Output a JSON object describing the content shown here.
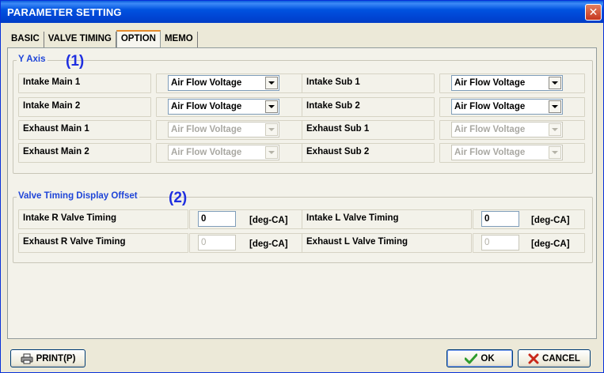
{
  "window": {
    "title": "PARAMETER SETTING",
    "close_glyph": "✕"
  },
  "tabs": [
    {
      "label": "BASIC",
      "active": false
    },
    {
      "label": "VALVE TIMING",
      "active": false
    },
    {
      "label": "OPTION",
      "active": true
    },
    {
      "label": "MEMO",
      "active": false
    }
  ],
  "y_axis": {
    "legend": "Y Axis",
    "marker": "(1)",
    "rows": [
      {
        "label": "Intake Main 1",
        "value": "Air Flow Voltage",
        "enabled": true
      },
      {
        "label": "Intake Main 2",
        "value": "Air Flow Voltage",
        "enabled": true
      },
      {
        "label": "Exhaust Main 1",
        "value": "Air Flow Voltage",
        "enabled": false
      },
      {
        "label": "Exhaust Main 2",
        "value": "Air Flow Voltage",
        "enabled": false
      },
      {
        "label": "Intake Sub 1",
        "value": "Air Flow Voltage",
        "enabled": true
      },
      {
        "label": "Intake Sub 2",
        "value": "Air Flow Voltage",
        "enabled": true
      },
      {
        "label": "Exhaust Sub 1",
        "value": "Air Flow Voltage",
        "enabled": false
      },
      {
        "label": "Exhaust Sub 2",
        "value": "Air Flow Voltage",
        "enabled": false
      }
    ]
  },
  "offset": {
    "legend": "Valve Timing Display Offset",
    "marker": "(2)",
    "rows": [
      {
        "label": "Intake R Valve Timing",
        "value": "0",
        "unit": "[deg-CA]",
        "enabled": true
      },
      {
        "label": "Exhaust R Valve Timing",
        "value": "0",
        "unit": "[deg-CA]",
        "enabled": false
      },
      {
        "label": "Intake L Valve Timing",
        "value": "0",
        "unit": "[deg-CA]",
        "enabled": true
      },
      {
        "label": "Exhaust L Valve Timing",
        "value": "0",
        "unit": "[deg-CA]",
        "enabled": false
      }
    ]
  },
  "buttons": {
    "print": "PRINT(P)",
    "ok": "OK",
    "cancel": "CANCEL"
  },
  "icons": {
    "print": "printer-icon",
    "ok": "checkmark-icon",
    "cancel": "x-icon",
    "dropdown": "chevron-down-icon"
  },
  "colors": {
    "title_bar": "#0053e0",
    "group_legend": "#1f45d8",
    "marker": "#1f2fe0",
    "ok_check": "#2e9c2e",
    "cancel_x": "#c8281a"
  }
}
